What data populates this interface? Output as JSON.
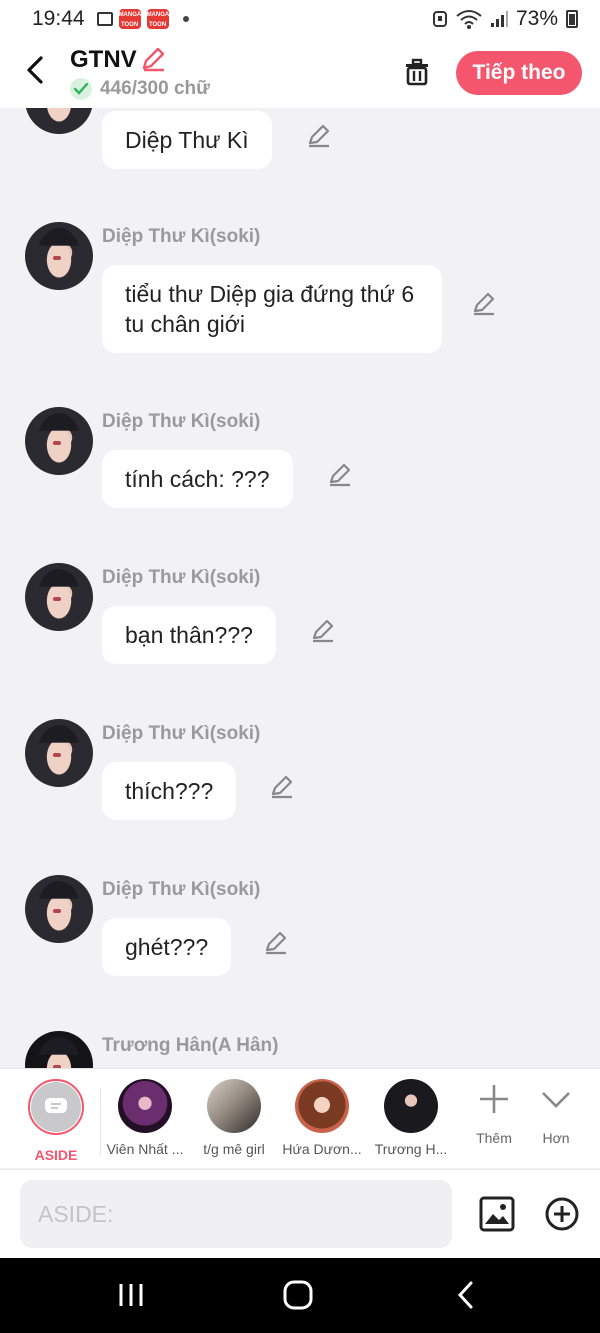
{
  "status_bar": {
    "time": "19:44",
    "battery": "73%",
    "app_badge": "MANGA TOON"
  },
  "header": {
    "title": "GTNV",
    "word_count": "446/300 chữ",
    "next_label": "Tiếp theo"
  },
  "messages": [
    {
      "sender": "",
      "text": "Diệp Thư Kì"
    },
    {
      "sender": "Diệp Thư Kì(soki)",
      "text": "tiểu thư Diệp gia đứng thứ 6 tu chân giới"
    },
    {
      "sender": "Diệp Thư Kì(soki)",
      "text": "tính cách: ???"
    },
    {
      "sender": "Diệp Thư Kì(soki)",
      "text": "bạn thân???"
    },
    {
      "sender": "Diệp Thư Kì(soki)",
      "text": "thích???"
    },
    {
      "sender": "Diệp Thư Kì(soki)",
      "text": "ghét???"
    },
    {
      "sender": "Trương Hân(A Hân)",
      "text": ""
    }
  ],
  "characters": [
    {
      "name": "ASIDE"
    },
    {
      "name": "Viên Nhất ..."
    },
    {
      "name": "t/g mê girl"
    },
    {
      "name": "Hứa Dươn..."
    },
    {
      "name": "Trương H..."
    }
  ],
  "more": {
    "add_label": "Thêm",
    "more_label": "Hơn"
  },
  "input": {
    "placeholder": "ASIDE:"
  },
  "colors": {
    "accent": "#f4566e",
    "background": "#f2f2f4",
    "bubble": "#ffffff"
  }
}
